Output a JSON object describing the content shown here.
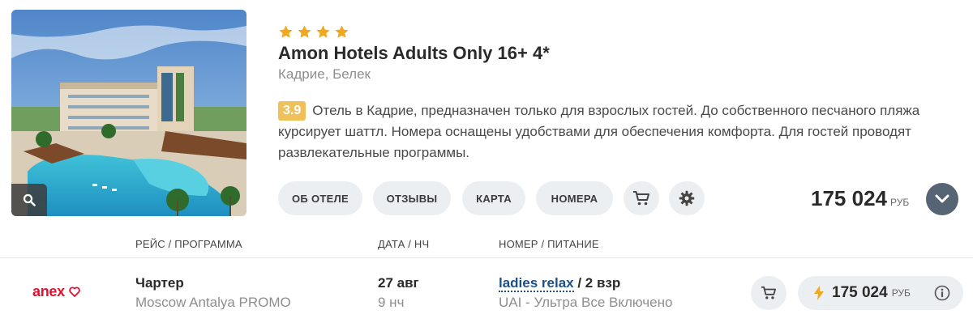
{
  "hotel": {
    "star_count": 4,
    "name": "Amon Hotels Adults Only 16+ 4*",
    "location": "Кадрие, Белек",
    "rating": "3.9",
    "description": "Отель в Кадрие, предназначен только для взрослых гостей. До собственного песчаного пляжа курсирует шаттл. Номера оснащены удобствами для обеспечения комфорта. Для гостей проводят развлекательные программы.",
    "price": "175 024",
    "currency": "РУБ"
  },
  "tabs": {
    "about": "ОБ ОТЕЛЕ",
    "reviews": "ОТЗЫВЫ",
    "map": "КАРТА",
    "rooms": "НОМЕРА"
  },
  "icons": {
    "star": "star-icon",
    "zoom": "magnifier-icon",
    "cart": "cart-icon",
    "settings": "gear-icon",
    "expand": "chevron-down-icon",
    "lightning": "lightning-icon",
    "info": "info-icon",
    "heart": "heart-icon"
  },
  "colors": {
    "star": "#f0a81e",
    "rating_badge": "#f0c05a",
    "operator_brand": "#e4112d",
    "link": "#1f4f8a",
    "expand_button": "#566474",
    "pill_bg": "#eceff2"
  },
  "table": {
    "headers": {
      "flight": "РЕЙС / ПРОГРАММА",
      "date": "ДАТА / НЧ",
      "room": "НОМЕР / ПИТАНИЕ"
    },
    "rows": [
      {
        "operator": "anex",
        "flight_type": "Чартер",
        "program": "Moscow Antalya PROMO",
        "date": "27 авг",
        "nights": "9 нч",
        "room": "ladies relax",
        "guests": " / 2 взр",
        "meal": "UAI - Ультра Все Включено",
        "price": "175 024",
        "currency": "РУБ"
      }
    ]
  }
}
